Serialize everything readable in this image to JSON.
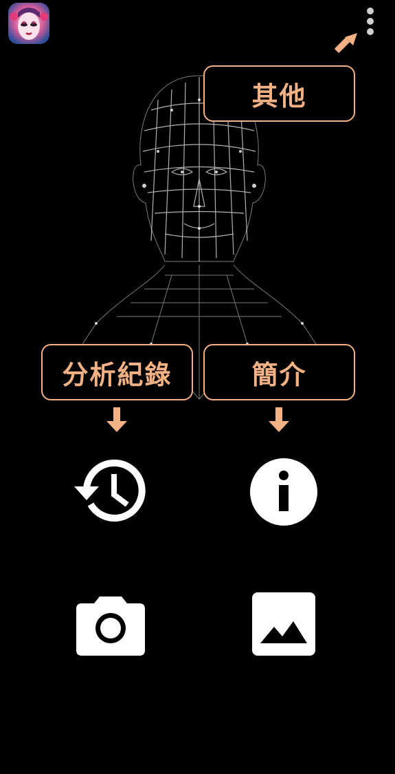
{
  "callouts": {
    "other": "其他",
    "history": "分析紀錄",
    "intro": "簡介"
  },
  "icons": {
    "app": "app-icon",
    "menu": "more-vert-icon",
    "history": "history-icon",
    "info": "info-icon",
    "camera": "camera-icon",
    "gallery": "image-icon"
  },
  "colors": {
    "background": "#000000",
    "accent": "#f4b183",
    "icon": "#ffffff"
  }
}
